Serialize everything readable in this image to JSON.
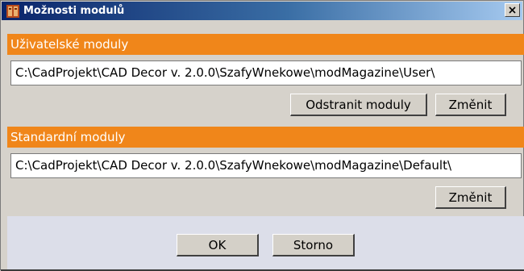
{
  "window": {
    "title": "Možnosti modulů",
    "icon": "app-module-icon",
    "close_icon": "close-icon"
  },
  "user_section": {
    "header": "Uživatelské moduly",
    "path_value": "C:\\CadProjekt\\CAD Decor v. 2.0.0\\SzafyWnekowe\\modMagazine\\User\\",
    "remove_button": "Odstranit moduly",
    "change_button": "Změnit"
  },
  "standard_section": {
    "header": "Standardní moduly",
    "path_value": "C:\\CadProjekt\\CAD Decor v. 2.0.0\\SzafyWnekowe\\modMagazine\\Default\\",
    "change_button": "Změnit"
  },
  "footer": {
    "ok_button": "OK",
    "cancel_button": "Storno"
  },
  "colors": {
    "title_bar_start": "#0a246a",
    "section_header": "#f0861a",
    "window_bg": "#d6d2cb",
    "footer_bg": "#dcdee9"
  }
}
